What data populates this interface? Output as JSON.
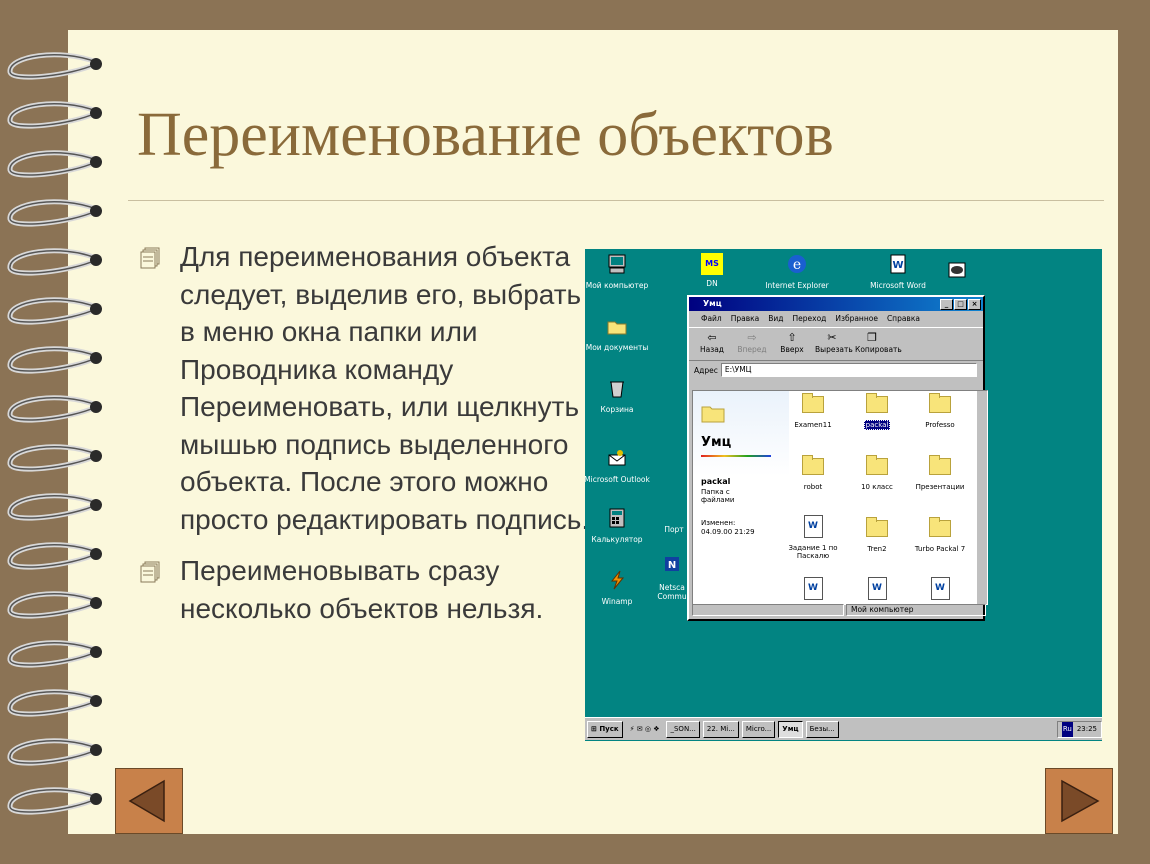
{
  "slide": {
    "title": "Переименование объектов",
    "bullets": [
      "Для переименования объекта следует, выделив его, выбрать в меню окна папки или Проводника команду Переименовать, или щелкнуть мышью подпись выделенного объекта. После этого можно просто редактировать подпись.",
      "Переименовывать сразу несколько объектов нельзя."
    ]
  },
  "colors": {
    "background": "#8b7355",
    "paper": "#fbf8dc",
    "title": "#8a6a3a",
    "nav_button": "#c8814a",
    "desktop": "#028482"
  },
  "nav": {
    "prev_icon": "triangle-left-icon",
    "next_icon": "triangle-right-icon"
  },
  "screenshot": {
    "desktop_icons": [
      "Мой компьютер",
      "DN",
      "Internet Explorer",
      "Microsoft Word",
      "Мои документы",
      "Корзина",
      "Microsoft Outlook",
      "Калькулятор",
      "Порт",
      "Winamp",
      "Netsca Commu"
    ],
    "dn_icon_label": "MS",
    "window": {
      "title": "Умц",
      "menu": [
        "Файл",
        "Правка",
        "Вид",
        "Переход",
        "Избранное",
        "Справка"
      ],
      "toolbar": [
        "Назад",
        "Вперед",
        "Вверх",
        "Вырезать",
        "Копировать"
      ],
      "address_label": "Адрес",
      "address_value": "E:\\УМЦ",
      "folder_title": "Умц",
      "selected_name": "packal",
      "selected_type": "Папка с файлами",
      "modified_label": "Изменен:",
      "modified_value": "04.09.00 21:29",
      "items": [
        "Examen11",
        "packal",
        "Professo",
        "robot",
        "10 класс",
        "Презентации",
        "Задание 1 по Паскалю",
        "Tren2",
        "Turbo Packal 7"
      ],
      "status_right": "Мой компьютер"
    },
    "taskbar": {
      "start": "Пуск",
      "tasks": [
        "_SON...",
        "22. Mi...",
        "Micro...",
        "Умц",
        "Безы..."
      ],
      "tray_lang": "Ru",
      "time": "23:25"
    }
  }
}
